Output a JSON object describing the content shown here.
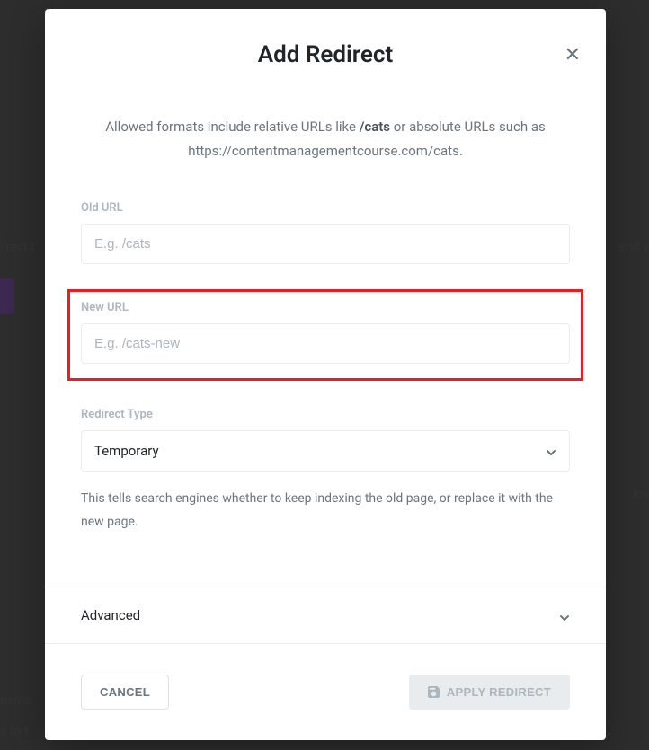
{
  "modal": {
    "title": "Add Redirect",
    "subtitle_prefix": "Allowed formats include relative URLs like ",
    "subtitle_bold": "/cats",
    "subtitle_middle": " or absolute URLs such as ",
    "subtitle_url": "https://contentmanagementcourse.com/cats",
    "subtitle_suffix": "."
  },
  "fields": {
    "old_url": {
      "label": "Old URL",
      "placeholder": "E.g. /cats",
      "value": ""
    },
    "new_url": {
      "label": "New URL",
      "placeholder": "E.g. /cats-new",
      "value": ""
    },
    "redirect_type": {
      "label": "Redirect Type",
      "selected": "Temporary",
      "help": "This tells search engines whether to keep indexing the old page, or replace it with the new page."
    }
  },
  "advanced": {
    "label": "Advanced"
  },
  "buttons": {
    "cancel": "CANCEL",
    "apply": "APPLY REDIRECT"
  },
  "background": {
    "text1": "lirect t",
    "text2": "end v",
    "text3": "iov",
    "text4": "nents",
    "text5": "s to t"
  }
}
